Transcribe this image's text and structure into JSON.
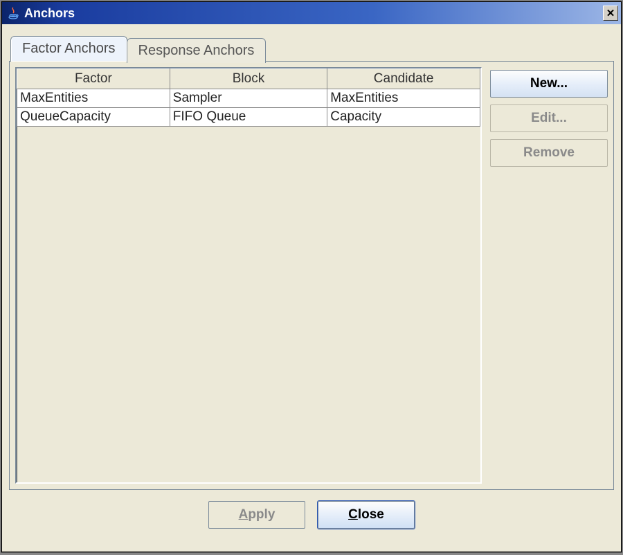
{
  "window": {
    "title": "Anchors"
  },
  "tabs": {
    "factor": "Factor Anchors",
    "response": "Response Anchors"
  },
  "table": {
    "headers": {
      "factor": "Factor",
      "block": "Block",
      "candidate": "Candidate"
    },
    "rows": [
      {
        "factor": "MaxEntities",
        "block": "Sampler",
        "candidate": "MaxEntities"
      },
      {
        "factor": "QueueCapacity",
        "block": "FIFO Queue",
        "candidate": "Capacity"
      }
    ]
  },
  "buttons": {
    "new": "New...",
    "edit": "Edit...",
    "remove": "Remove",
    "apply": "Apply",
    "close": "Close"
  }
}
